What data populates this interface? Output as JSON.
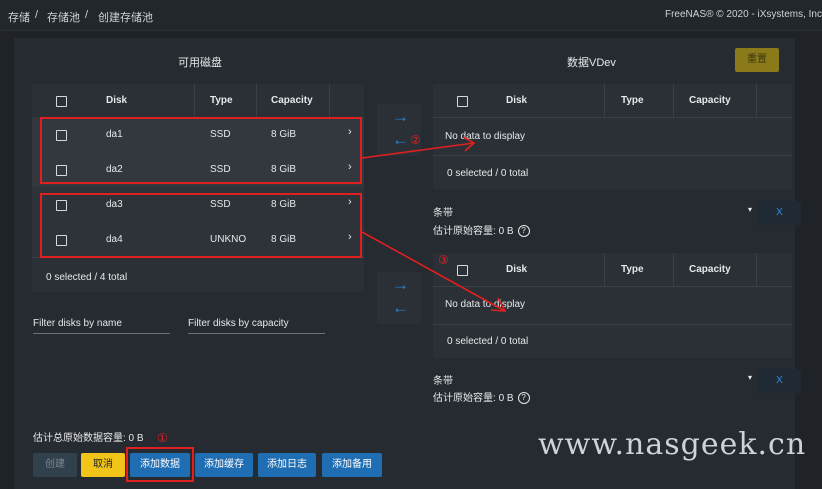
{
  "breadcrumb": {
    "items": [
      "存储",
      "存储池",
      "创建存储池"
    ],
    "sep": "/"
  },
  "copyright": "FreeNAS® © 2020 - iXsystems, Inc",
  "available": {
    "title": "可用磁盘",
    "columns": [
      "Disk",
      "Type",
      "Capacity"
    ],
    "rows": [
      {
        "disk": "da1",
        "type": "SSD",
        "capacity": "8 GiB"
      },
      {
        "disk": "da2",
        "type": "SSD",
        "capacity": "8 GiB"
      },
      {
        "disk": "da3",
        "type": "SSD",
        "capacity": "8 GiB"
      },
      {
        "disk": "da4",
        "type": "UNKNO",
        "capacity": "8 GiB"
      }
    ],
    "selected": "0 selected / 4 total",
    "filter_name": "Filter disks by name",
    "filter_capacity": "Filter disks by capacity"
  },
  "vdev": {
    "title": "数据VDev",
    "reset_label": "重置",
    "columns": [
      "Disk",
      "Type",
      "Capacity"
    ],
    "groups": [
      {
        "empty": "No data to display",
        "selected": "0 selected / 0 total",
        "layout": "条带",
        "estimate_label": "估计原始容量:",
        "estimate_value": "0 B",
        "remove": "X"
      },
      {
        "empty": "No data to display",
        "selected": "0 selected / 0 total",
        "layout": "条带",
        "estimate_label": "估计原始容量:",
        "estimate_value": "0 B",
        "remove": "X"
      }
    ]
  },
  "total_estimate": "估计总原始数据容量: 0 B",
  "buttons": {
    "create": "创建",
    "cancel": "取消",
    "add_data": "添加数据",
    "add_cache": "添加缓存",
    "add_log": "添加日志",
    "add_spare": "添加备用"
  },
  "icons": {
    "arrow_right": "→",
    "arrow_left": "←",
    "chevron": "›",
    "dropdown": "▾",
    "help": "?"
  },
  "annotations": {
    "one": "①",
    "two": "②",
    "three": "③"
  },
  "watermark": "www.nasgeek.cn",
  "colors": {
    "accent": "#1e88e5",
    "annotation": "#e02020",
    "cancel": "#f0c419"
  }
}
